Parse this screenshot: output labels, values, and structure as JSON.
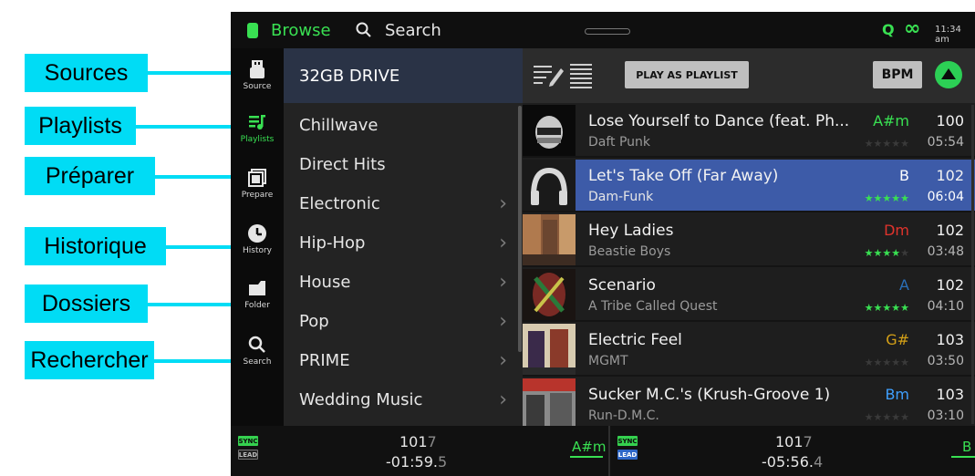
{
  "callouts": [
    {
      "label": "Sources"
    },
    {
      "label": "Playlists"
    },
    {
      "label": "Préparer"
    },
    {
      "label": "Historique"
    },
    {
      "label": "Dossiers"
    },
    {
      "label": "Rechercher"
    }
  ],
  "topbar": {
    "browse_label": "Browse",
    "search_label": "Search",
    "q_label": "Q",
    "link_symbol": "∞",
    "time": "11:34 am"
  },
  "rail": [
    {
      "label": "Source",
      "icon": "usb-drive-icon"
    },
    {
      "label": "Playlists",
      "icon": "playlist-icon",
      "active": true
    },
    {
      "label": "Prepare",
      "icon": "prepare-icon"
    },
    {
      "label": "History",
      "icon": "clock-icon"
    },
    {
      "label": "Folder",
      "icon": "folder-icon"
    },
    {
      "label": "Search",
      "icon": "search-icon"
    }
  ],
  "crates": {
    "header": "32GB DRIVE",
    "items": [
      {
        "label": "Chillwave",
        "has_children": false
      },
      {
        "label": "Direct Hits",
        "has_children": false
      },
      {
        "label": "Electronic",
        "has_children": true
      },
      {
        "label": "Hip-Hop",
        "has_children": true
      },
      {
        "label": "House",
        "has_children": true
      },
      {
        "label": "Pop",
        "has_children": true
      },
      {
        "label": "PRIME",
        "has_children": true
      },
      {
        "label": "Wedding Music",
        "has_children": true
      }
    ],
    "chevron": "›"
  },
  "toolbar": {
    "play_as_playlist": "PLAY AS PLAYLIST",
    "bpm": "BPM"
  },
  "tracks": [
    {
      "title": "Lose Yourself to Dance (feat. Ph...",
      "artist": "Daft Punk",
      "key": "A#m",
      "key_color": "#39e052",
      "rating": 0,
      "bpm": "100",
      "duration": "05:54"
    },
    {
      "title": "Let's Take Off (Far Away)",
      "artist": "Dam-Funk",
      "key": "B",
      "key_color": "#ffffff",
      "rating": 5,
      "bpm": "102",
      "duration": "06:04",
      "selected": true
    },
    {
      "title": "Hey Ladies",
      "artist": "Beastie Boys",
      "key": "Dm",
      "key_color": "#e0332c",
      "rating": 4,
      "bpm": "102",
      "duration": "03:48"
    },
    {
      "title": "Scenario",
      "artist": "A Tribe Called Quest",
      "key": "A",
      "key_color": "#2a6fb8",
      "rating": 5,
      "bpm": "102",
      "duration": "04:10"
    },
    {
      "title": "Electric Feel",
      "artist": "MGMT",
      "key": "G#",
      "key_color": "#d4a017",
      "rating": 0,
      "bpm": "103",
      "duration": "03:50"
    },
    {
      "title": "Sucker M.C.'s (Krush-Groove 1)",
      "artist": "Run-D.M.C.",
      "key": "Bm",
      "key_color": "#3fa0ff",
      "rating": 0,
      "bpm": "103",
      "duration": "03:10"
    }
  ],
  "decks": [
    {
      "sync": "SYNC",
      "lead": "LEAD",
      "bpm_main": "101",
      "bpm_frac": "7",
      "time_main": "-01:59.",
      "time_frac": "5",
      "key": "A#m",
      "key_color": "#39e052"
    },
    {
      "sync": "SYNC",
      "lead": "LEAD",
      "bpm_main": "101",
      "bpm_frac": "7",
      "time_main": "-05:56.",
      "time_frac": "4",
      "key": "B",
      "key_color": "#39e052"
    }
  ]
}
